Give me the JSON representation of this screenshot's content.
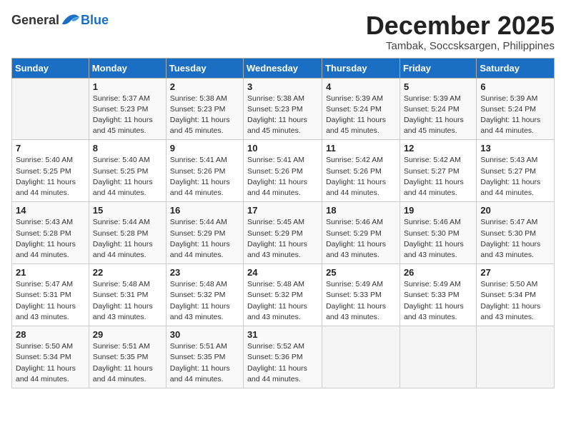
{
  "header": {
    "logo_general": "General",
    "logo_blue": "Blue",
    "month_title": "December 2025",
    "location": "Tambak, Soccsksargen, Philippines"
  },
  "days_of_week": [
    "Sunday",
    "Monday",
    "Tuesday",
    "Wednesday",
    "Thursday",
    "Friday",
    "Saturday"
  ],
  "weeks": [
    [
      {
        "day": "",
        "info": ""
      },
      {
        "day": "1",
        "info": "Sunrise: 5:37 AM\nSunset: 5:23 PM\nDaylight: 11 hours\nand 45 minutes."
      },
      {
        "day": "2",
        "info": "Sunrise: 5:38 AM\nSunset: 5:23 PM\nDaylight: 11 hours\nand 45 minutes."
      },
      {
        "day": "3",
        "info": "Sunrise: 5:38 AM\nSunset: 5:23 PM\nDaylight: 11 hours\nand 45 minutes."
      },
      {
        "day": "4",
        "info": "Sunrise: 5:39 AM\nSunset: 5:24 PM\nDaylight: 11 hours\nand 45 minutes."
      },
      {
        "day": "5",
        "info": "Sunrise: 5:39 AM\nSunset: 5:24 PM\nDaylight: 11 hours\nand 45 minutes."
      },
      {
        "day": "6",
        "info": "Sunrise: 5:39 AM\nSunset: 5:24 PM\nDaylight: 11 hours\nand 44 minutes."
      }
    ],
    [
      {
        "day": "7",
        "info": "Sunrise: 5:40 AM\nSunset: 5:25 PM\nDaylight: 11 hours\nand 44 minutes."
      },
      {
        "day": "8",
        "info": "Sunrise: 5:40 AM\nSunset: 5:25 PM\nDaylight: 11 hours\nand 44 minutes."
      },
      {
        "day": "9",
        "info": "Sunrise: 5:41 AM\nSunset: 5:26 PM\nDaylight: 11 hours\nand 44 minutes."
      },
      {
        "day": "10",
        "info": "Sunrise: 5:41 AM\nSunset: 5:26 PM\nDaylight: 11 hours\nand 44 minutes."
      },
      {
        "day": "11",
        "info": "Sunrise: 5:42 AM\nSunset: 5:26 PM\nDaylight: 11 hours\nand 44 minutes."
      },
      {
        "day": "12",
        "info": "Sunrise: 5:42 AM\nSunset: 5:27 PM\nDaylight: 11 hours\nand 44 minutes."
      },
      {
        "day": "13",
        "info": "Sunrise: 5:43 AM\nSunset: 5:27 PM\nDaylight: 11 hours\nand 44 minutes."
      }
    ],
    [
      {
        "day": "14",
        "info": "Sunrise: 5:43 AM\nSunset: 5:28 PM\nDaylight: 11 hours\nand 44 minutes."
      },
      {
        "day": "15",
        "info": "Sunrise: 5:44 AM\nSunset: 5:28 PM\nDaylight: 11 hours\nand 44 minutes."
      },
      {
        "day": "16",
        "info": "Sunrise: 5:44 AM\nSunset: 5:29 PM\nDaylight: 11 hours\nand 44 minutes."
      },
      {
        "day": "17",
        "info": "Sunrise: 5:45 AM\nSunset: 5:29 PM\nDaylight: 11 hours\nand 43 minutes."
      },
      {
        "day": "18",
        "info": "Sunrise: 5:46 AM\nSunset: 5:29 PM\nDaylight: 11 hours\nand 43 minutes."
      },
      {
        "day": "19",
        "info": "Sunrise: 5:46 AM\nSunset: 5:30 PM\nDaylight: 11 hours\nand 43 minutes."
      },
      {
        "day": "20",
        "info": "Sunrise: 5:47 AM\nSunset: 5:30 PM\nDaylight: 11 hours\nand 43 minutes."
      }
    ],
    [
      {
        "day": "21",
        "info": "Sunrise: 5:47 AM\nSunset: 5:31 PM\nDaylight: 11 hours\nand 43 minutes."
      },
      {
        "day": "22",
        "info": "Sunrise: 5:48 AM\nSunset: 5:31 PM\nDaylight: 11 hours\nand 43 minutes."
      },
      {
        "day": "23",
        "info": "Sunrise: 5:48 AM\nSunset: 5:32 PM\nDaylight: 11 hours\nand 43 minutes."
      },
      {
        "day": "24",
        "info": "Sunrise: 5:48 AM\nSunset: 5:32 PM\nDaylight: 11 hours\nand 43 minutes."
      },
      {
        "day": "25",
        "info": "Sunrise: 5:49 AM\nSunset: 5:33 PM\nDaylight: 11 hours\nand 43 minutes."
      },
      {
        "day": "26",
        "info": "Sunrise: 5:49 AM\nSunset: 5:33 PM\nDaylight: 11 hours\nand 43 minutes."
      },
      {
        "day": "27",
        "info": "Sunrise: 5:50 AM\nSunset: 5:34 PM\nDaylight: 11 hours\nand 43 minutes."
      }
    ],
    [
      {
        "day": "28",
        "info": "Sunrise: 5:50 AM\nSunset: 5:34 PM\nDaylight: 11 hours\nand 44 minutes."
      },
      {
        "day": "29",
        "info": "Sunrise: 5:51 AM\nSunset: 5:35 PM\nDaylight: 11 hours\nand 44 minutes."
      },
      {
        "day": "30",
        "info": "Sunrise: 5:51 AM\nSunset: 5:35 PM\nDaylight: 11 hours\nand 44 minutes."
      },
      {
        "day": "31",
        "info": "Sunrise: 5:52 AM\nSunset: 5:36 PM\nDaylight: 11 hours\nand 44 minutes."
      },
      {
        "day": "",
        "info": ""
      },
      {
        "day": "",
        "info": ""
      },
      {
        "day": "",
        "info": ""
      }
    ]
  ]
}
